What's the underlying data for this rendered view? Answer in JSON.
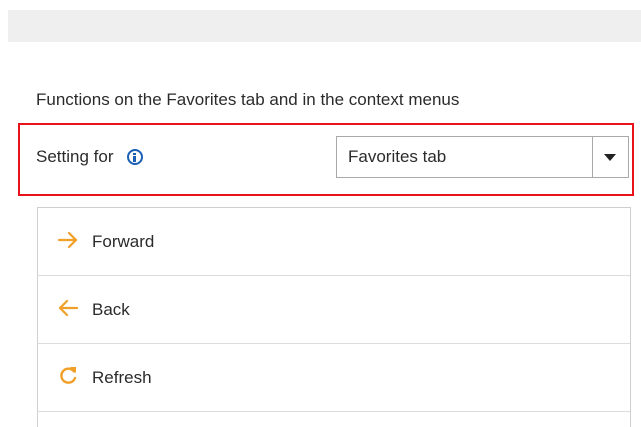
{
  "section": {
    "title": "Functions on the Favorites tab and in the context menus"
  },
  "setting": {
    "label": "Setting for",
    "info_icon": "info-icon",
    "selected_value": "Favorites tab",
    "dropdown_icon": "chevron-down-icon"
  },
  "functions": [
    {
      "label": "Forward",
      "icon": "arrow-right-icon"
    },
    {
      "label": "Back",
      "icon": "arrow-left-icon"
    },
    {
      "label": "Refresh",
      "icon": "refresh-icon"
    }
  ],
  "colors": {
    "highlight": "#e8121b",
    "icon_accent": "#f0a028",
    "info": "#1a5fb4"
  }
}
